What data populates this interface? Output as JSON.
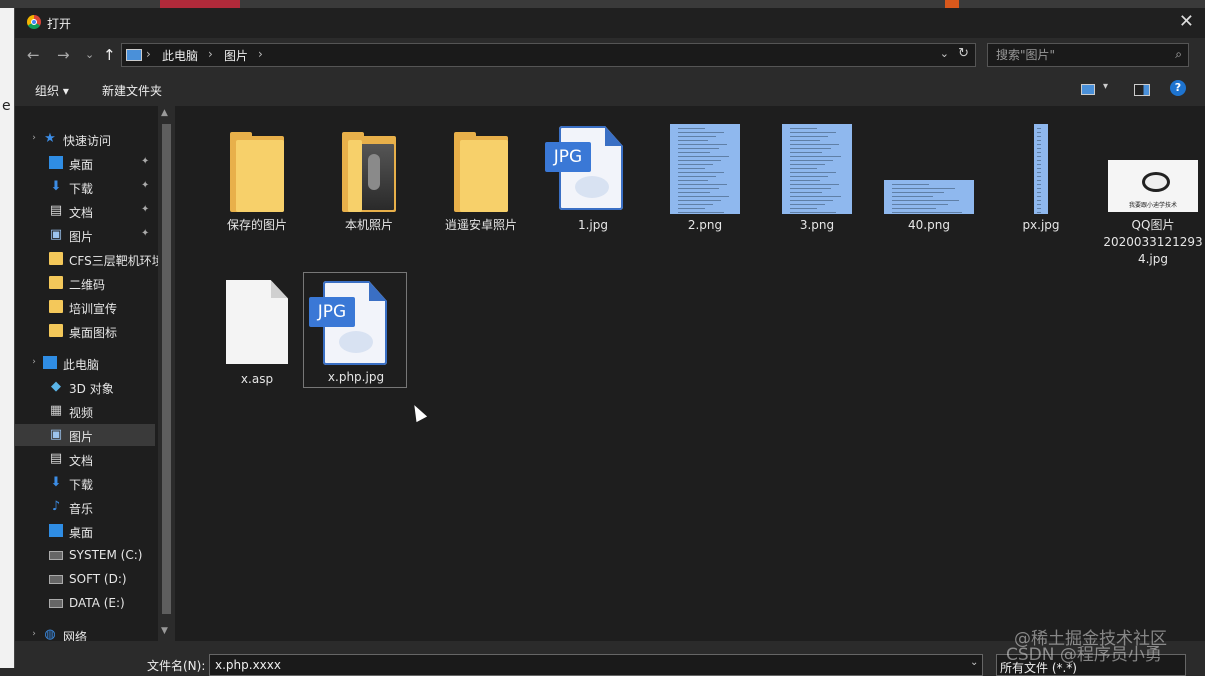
{
  "window": {
    "title": "打开",
    "close_glyph": "✕"
  },
  "nav": {
    "back": "←",
    "forward": "→",
    "recent": "⌄",
    "up": "↑",
    "breadcrumb": [
      "此电脑",
      "图片"
    ],
    "separator": "›",
    "dropdown": "⌄",
    "refresh": "↻"
  },
  "search": {
    "placeholder": "搜索\"图片\"",
    "icon": "⌕"
  },
  "toolbar": {
    "organize": "组织 ▾",
    "new_folder": "新建文件夹",
    "help": "?"
  },
  "sidebar": {
    "items": [
      {
        "label": "快速访问",
        "icon": "star-icon",
        "pinned": false
      },
      {
        "label": "桌面",
        "icon": "desktop-icon",
        "pinned": true
      },
      {
        "label": "下载",
        "icon": "download-icon",
        "pinned": true
      },
      {
        "label": "文档",
        "icon": "document-icon",
        "pinned": true
      },
      {
        "label": "图片",
        "icon": "pictures-icon",
        "pinned": true
      },
      {
        "label": "CFS三层靶机环境",
        "icon": "folder-icon",
        "pinned": false
      },
      {
        "label": "二维码",
        "icon": "folder-icon",
        "pinned": false
      },
      {
        "label": "培训宣传",
        "icon": "folder-icon",
        "pinned": false
      },
      {
        "label": "桌面图标",
        "icon": "folder-icon",
        "pinned": false
      },
      {
        "label": "此电脑",
        "icon": "computer-icon",
        "pinned": false
      },
      {
        "label": "3D 对象",
        "icon": "3d-objects-icon",
        "pinned": false
      },
      {
        "label": "视频",
        "icon": "video-icon",
        "pinned": false
      },
      {
        "label": "图片",
        "icon": "pictures-icon",
        "pinned": false,
        "selected": true
      },
      {
        "label": "文档",
        "icon": "document-icon",
        "pinned": false
      },
      {
        "label": "下载",
        "icon": "download-icon",
        "pinned": false
      },
      {
        "label": "音乐",
        "icon": "music-icon",
        "pinned": false
      },
      {
        "label": "桌面",
        "icon": "desktop-icon",
        "pinned": false
      },
      {
        "label": "SYSTEM (C:)",
        "icon": "drive-icon",
        "pinned": false
      },
      {
        "label": "SOFT (D:)",
        "icon": "drive-icon",
        "pinned": false
      },
      {
        "label": "DATA (E:)",
        "icon": "drive-icon",
        "pinned": false
      },
      {
        "label": "网络",
        "icon": "network-icon",
        "pinned": false
      }
    ],
    "pin_glyph": "📌"
  },
  "files": [
    {
      "name": "保存的图片",
      "kind": "folder"
    },
    {
      "name": "本机照片",
      "kind": "folder-photo"
    },
    {
      "name": "逍遥安卓照片",
      "kind": "folder"
    },
    {
      "name": "1.jpg",
      "kind": "jpg-icon",
      "badge": "JPG"
    },
    {
      "name": "2.png",
      "kind": "thumb-doc"
    },
    {
      "name": "3.png",
      "kind": "thumb-doc"
    },
    {
      "name": "40.png",
      "kind": "thumb-wide"
    },
    {
      "name": "px.jpg",
      "kind": "thumb-narrow"
    },
    {
      "name": "QQ图片\n2020033121293\n4.jpg",
      "kind": "thumb-meme",
      "caption": "我要跟小迪学技术"
    },
    {
      "name": "x.asp",
      "kind": "blank"
    },
    {
      "name": "x.php.jpg",
      "kind": "jpg-icon",
      "badge": "JPG",
      "selected": true
    }
  ],
  "footer": {
    "filename_label": "文件名(N):",
    "filename_value": "x.php.xxxx",
    "filter_value": "所有文件 (*.*)"
  },
  "watermarks": [
    "@稀土掘金技术社区",
    "CSDN @程序员小勇"
  ]
}
